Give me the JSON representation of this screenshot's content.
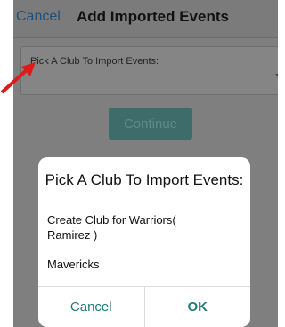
{
  "navbar": {
    "cancel_label": "Cancel",
    "title": "Add Imported Events"
  },
  "picker": {
    "label": "Pick A Club To Import Events:"
  },
  "continue_label": "Continue",
  "dialog": {
    "title": "Pick A Club To Import Events:",
    "options": [
      "Create Club for Warriors( Ramirez )",
      "Mavericks"
    ],
    "cancel_label": "Cancel",
    "ok_label": "OK"
  },
  "colors": {
    "accent": "#1f7a7a",
    "annotation_arrow": "#e01a1a"
  }
}
